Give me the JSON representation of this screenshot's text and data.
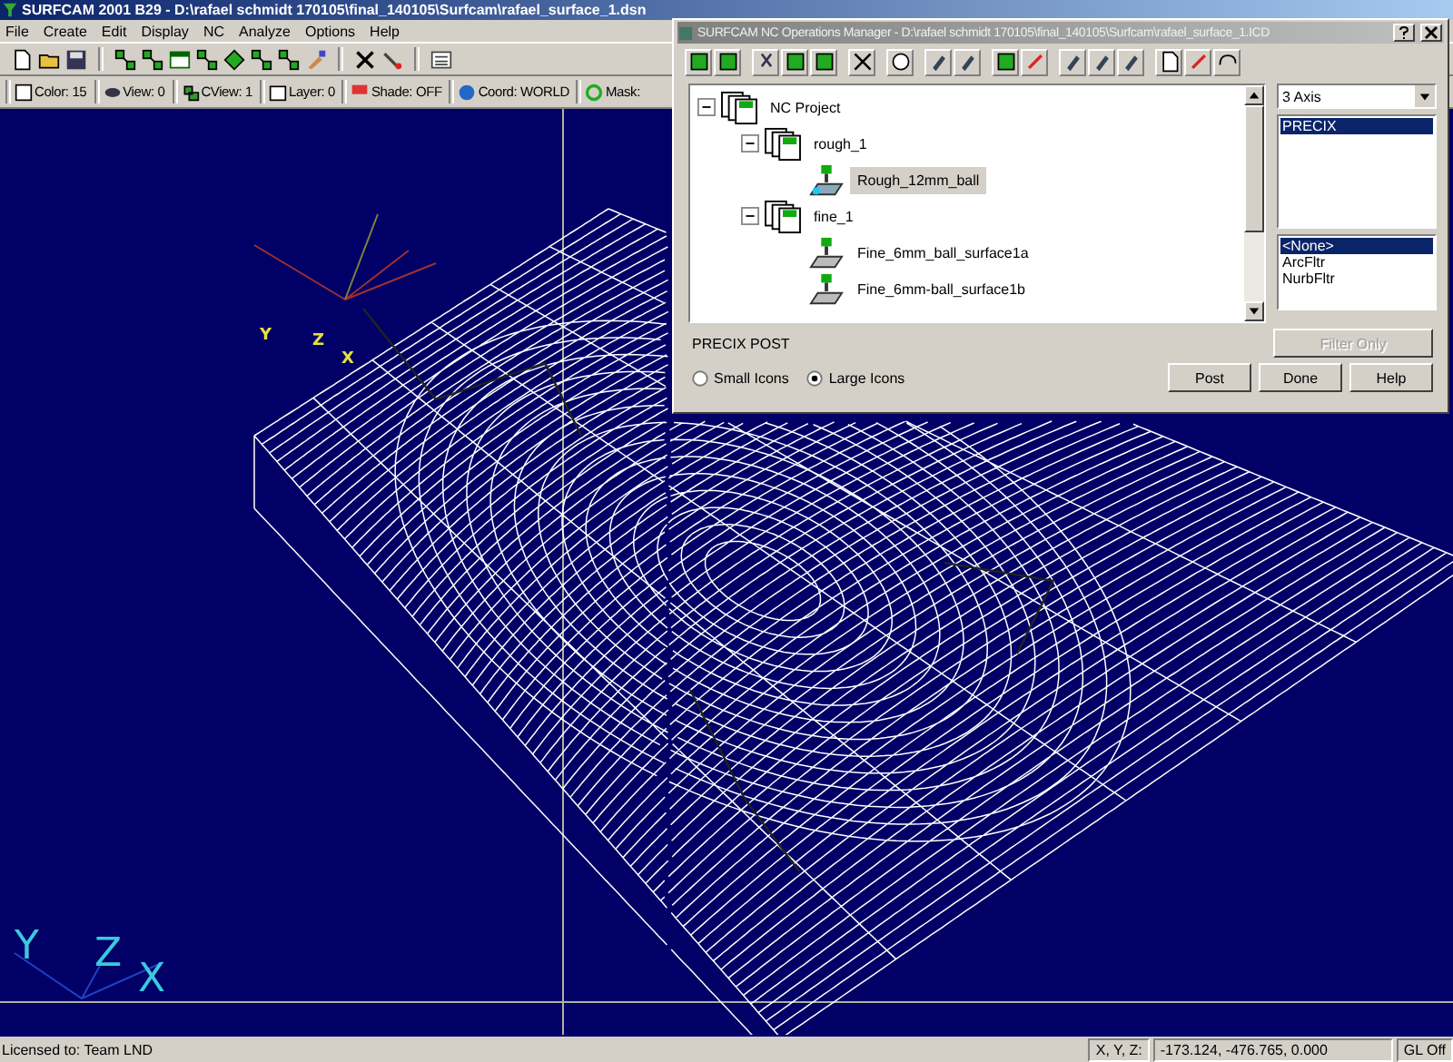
{
  "window": {
    "title": "SURFCAM 2001 B29 - D:\\rafael schmidt 170105\\final_140105\\Surfcam\\rafael_surface_1.dsn"
  },
  "menu": [
    "File",
    "Create",
    "Edit",
    "Display",
    "NC",
    "Analyze",
    "Options",
    "Help"
  ],
  "status_items": [
    {
      "label": "Color: 15"
    },
    {
      "label": "View: 0"
    },
    {
      "label": "CView: 1"
    },
    {
      "label": "Layer: 0"
    },
    {
      "label": "Shade: OFF"
    },
    {
      "label": "Coord: WORLD"
    },
    {
      "label": "Mask: "
    }
  ],
  "viewport": {
    "origin_axes": [
      "Y",
      "Z",
      "X"
    ],
    "view_axes": [
      "Y",
      "Z",
      "X"
    ]
  },
  "dialog": {
    "title": "SURFCAM NC Operations Manager - D:\\rafael schmidt 170105\\final_140105\\Surfcam\\rafael_surface_1.ICD",
    "tree": [
      {
        "label": "NC Project",
        "kind": "project",
        "expanded": true,
        "children": [
          {
            "label": "rough_1",
            "kind": "group",
            "expanded": true,
            "children": [
              {
                "label": "Rough_12mm_ball",
                "kind": "rough",
                "selected": true
              }
            ]
          },
          {
            "label": "fine_1",
            "kind": "group",
            "expanded": true,
            "children": [
              {
                "label": "Fine_6mm_ball_surface1a",
                "kind": "finish",
                "selected": false
              },
              {
                "label": "Fine_6mm-ball_surface1b",
                "kind": "finish",
                "selected": false
              }
            ]
          }
        ]
      }
    ],
    "axis_select": {
      "value": "3 Axis"
    },
    "posts": [
      {
        "label": "PRECIX",
        "selected": true
      }
    ],
    "filters": [
      {
        "label": "<None>",
        "selected": true
      },
      {
        "label": "ArcFltr",
        "selected": false
      },
      {
        "label": "NurbFltr",
        "selected": false
      }
    ],
    "post_label": "PRECIX POST",
    "filter_button": {
      "label": "Filter Only",
      "disabled": true
    },
    "icon_size": [
      {
        "label": "Small Icons",
        "selected": false
      },
      {
        "label": "Large Icons",
        "selected": true
      }
    ],
    "buttons": [
      "Post",
      "Done",
      "Help"
    ]
  },
  "status_bar": {
    "license": "Licensed to: Team LND",
    "coord_label": "X, Y, Z:",
    "coords": "-173.124, -476.765, 0.000",
    "gl": "GL Off"
  }
}
